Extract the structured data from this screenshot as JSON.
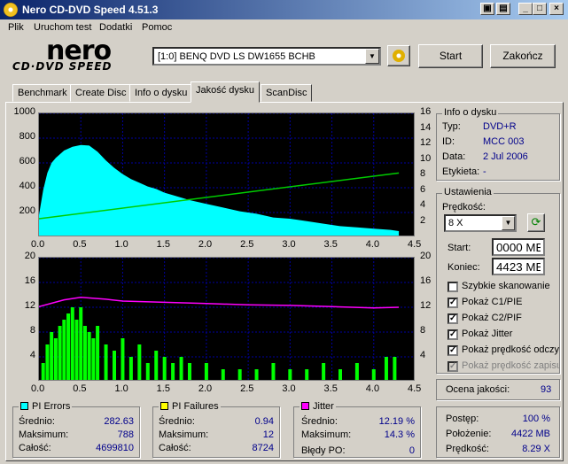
{
  "window": {
    "title": "Nero CD-DVD Speed 4.51.3"
  },
  "menu": [
    "Plik",
    "Uruchom test",
    "Dodatki",
    "Pomoc"
  ],
  "logo": {
    "brand": "nero",
    "sub": "CD·DVD SPEED"
  },
  "drive": {
    "selected": "[1:0]  BENQ DVD LS DW1655 BCHB"
  },
  "buttons": {
    "start": "Start",
    "exit": "Zakończ"
  },
  "tabs": [
    "Benchmark",
    "Create Disc",
    "Info o dysku",
    "Jakość dysku",
    "ScanDisc"
  ],
  "active_tab": "Jakość dysku",
  "disc_info": {
    "title": "Info o dysku",
    "type_label": "Typ:",
    "type": "DVD+R",
    "id_label": "ID:",
    "id": "MCC 003",
    "date_label": "Data:",
    "date": "2 Jul 2006",
    "label_label": "Etykieta:",
    "label": "-"
  },
  "settings": {
    "title": "Ustawienia",
    "speed_label": "Prędkość:",
    "speed": "8 X",
    "start_label": "Start:",
    "start": "0000 MB",
    "end_label": "Koniec:",
    "end": "4423 MB",
    "checks": [
      {
        "label": "Szybkie skanowanie",
        "checked": false,
        "disabled": false
      },
      {
        "label": "Pokaż C1/PIE",
        "checked": true,
        "disabled": false
      },
      {
        "label": "Pokaż C2/PIF",
        "checked": true,
        "disabled": false
      },
      {
        "label": "Pokaż Jitter",
        "checked": true,
        "disabled": false
      },
      {
        "label": "Pokaż prędkość odczytu",
        "checked": true,
        "disabled": false
      },
      {
        "label": "Pokaż prędkość zapisu",
        "checked": true,
        "disabled": true
      }
    ]
  },
  "quality": {
    "label": "Ocena jakości:",
    "value": "93"
  },
  "pi_errors": {
    "title": "PI Errors",
    "color": "#00ffff",
    "avg_label": "Średnio:",
    "avg": "282.63",
    "max_label": "Maksimum:",
    "max": "788",
    "total_label": "Całość:",
    "total": "4699810"
  },
  "pi_failures": {
    "title": "PI Failures",
    "color": "#ffff00",
    "avg_label": "Średnio:",
    "avg": "0.94",
    "max_label": "Maksimum:",
    "max": "12",
    "total_label": "Całość:",
    "total": "8724"
  },
  "jitter": {
    "title": "Jitter",
    "color": "#ff00ff",
    "avg_label": "Średnio:",
    "avg": "12.19 %",
    "max_label": "Maksimum:",
    "max": "14.3 %",
    "po_label": "Błędy PO:",
    "po": "0"
  },
  "progress": {
    "label": "Postęp:",
    "value": "100 %",
    "pos_label": "Położenie:",
    "pos": "4422 MB",
    "speed_label": "Prędkość:",
    "speed": "8.29 X"
  },
  "chart_data": [
    {
      "type": "area",
      "series": [
        {
          "name": "PI Errors",
          "color": "#00ffff",
          "x": [
            0.0,
            0.05,
            0.1,
            0.15,
            0.2,
            0.3,
            0.4,
            0.5,
            0.6,
            0.7,
            0.8,
            0.9,
            1.0,
            1.1,
            1.2,
            1.3,
            1.4,
            1.5,
            1.6,
            1.8,
            2.0,
            2.2,
            2.4,
            2.6,
            2.8,
            3.0,
            3.2,
            3.4,
            3.6,
            3.8,
            4.0,
            4.2,
            4.3
          ],
          "values": [
            180,
            380,
            520,
            600,
            640,
            700,
            730,
            745,
            740,
            690,
            620,
            560,
            510,
            470,
            440,
            410,
            390,
            360,
            340,
            300,
            270,
            240,
            210,
            190,
            160,
            150,
            130,
            110,
            90,
            80,
            70,
            60,
            50
          ]
        },
        {
          "name": "read speed",
          "color": "#00cc00",
          "x": [
            0.0,
            4.3
          ],
          "values": [
            2.4,
            8.3
          ]
        }
      ],
      "xlim": [
        0,
        4.5
      ],
      "ylim": [
        0,
        1000
      ],
      "y2lim": [
        0,
        16
      ],
      "xticks": [
        "0.0",
        "0.5",
        "1.0",
        "1.5",
        "2.0",
        "2.5",
        "3.0",
        "3.5",
        "4.0",
        "4.5"
      ],
      "yticks": [
        "1000",
        "800",
        "600",
        "400",
        "200"
      ],
      "y2ticks": [
        "16",
        "14",
        "12",
        "10",
        "8",
        "6",
        "4",
        "2"
      ]
    },
    {
      "type": "bar",
      "series": [
        {
          "name": "PI Failures",
          "color": "#00ff00",
          "x": [
            0.05,
            0.1,
            0.15,
            0.2,
            0.25,
            0.3,
            0.35,
            0.4,
            0.45,
            0.5,
            0.55,
            0.6,
            0.65,
            0.7,
            0.8,
            0.9,
            1.0,
            1.1,
            1.2,
            1.3,
            1.4,
            1.5,
            1.6,
            1.7,
            1.8,
            2.0,
            2.2,
            2.4,
            2.6,
            2.8,
            3.0,
            3.2,
            3.4,
            3.6,
            3.8,
            4.0,
            4.15,
            4.25
          ],
          "values": [
            3,
            6,
            8,
            7,
            9,
            10,
            11,
            12,
            10,
            12,
            9,
            8,
            7,
            9,
            6,
            5,
            7,
            4,
            6,
            3,
            5,
            4,
            3,
            4,
            3,
            3,
            2,
            2,
            2,
            3,
            2,
            2,
            3,
            2,
            3,
            2,
            4,
            4
          ]
        },
        {
          "name": "Jitter",
          "color": "#ff00ff",
          "x": [
            0.0,
            0.3,
            0.5,
            0.8,
            1.0,
            1.5,
            2.0,
            2.5,
            3.0,
            3.5,
            4.0,
            4.3
          ],
          "values": [
            12.1,
            13.2,
            13.6,
            13.3,
            13.0,
            12.8,
            12.6,
            12.4,
            12.3,
            12.1,
            11.9,
            12.0
          ]
        }
      ],
      "xlim": [
        0,
        4.5
      ],
      "ylim": [
        0,
        20
      ],
      "y2lim": [
        0,
        20
      ],
      "xticks": [
        "0.0",
        "0.5",
        "1.0",
        "1.5",
        "2.0",
        "2.5",
        "3.0",
        "3.5",
        "4.0",
        "4.5"
      ],
      "yticks": [
        "20",
        "16",
        "12",
        "8",
        "4"
      ],
      "y2ticks": [
        "20",
        "16",
        "12",
        "8",
        "4"
      ]
    }
  ]
}
